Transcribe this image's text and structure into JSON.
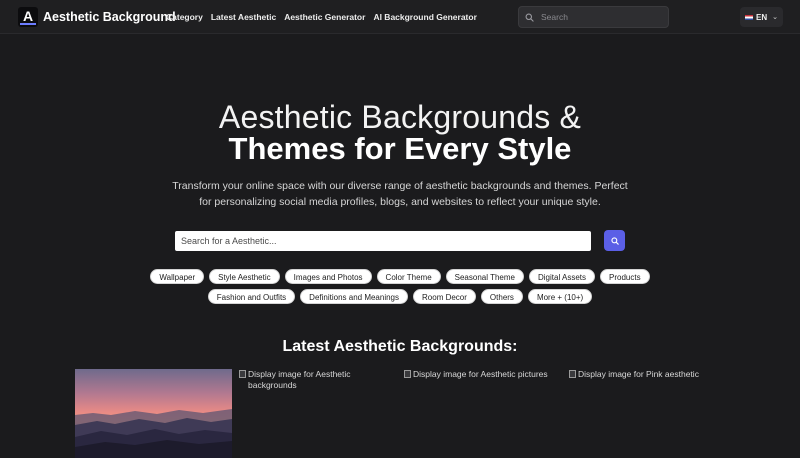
{
  "header": {
    "logo_letter": "A",
    "brand": "Aesthetic Background",
    "nav": [
      "Category",
      "Latest Aesthetic",
      "Aesthetic Generator",
      "AI Background Generator"
    ],
    "search_placeholder": "Search",
    "lang": "EN",
    "icons": [
      "search-icon",
      "flag-icon",
      "chevron-down-icon"
    ]
  },
  "hero": {
    "line1": "Aesthetic Backgrounds &",
    "line2": "Themes for Every Style",
    "subtitle": "Transform your online space with our diverse range of aesthetic backgrounds and themes. Perfect for personalizing social media profiles, blogs, and websites to reflect your unique style.",
    "search_placeholder": "Search for a Aesthetic...",
    "search_button_icon": "search-icon"
  },
  "categories": [
    "Wallpaper",
    "Style Aesthetic",
    "Images and Photos",
    "Color Theme",
    "Seasonal Theme",
    "Digital Assets",
    "Products",
    "Fashion and Outfits",
    "Definitions and Meanings",
    "Room Decor",
    "Others",
    "More + (10+)"
  ],
  "latest": {
    "title": "Latest Aesthetic Backgrounds:",
    "images": [
      {
        "alt": ""
      },
      {
        "alt": "Display image for Aesthetic backgrounds"
      },
      {
        "alt": "Display image for Aesthetic pictures"
      },
      {
        "alt": "Display image for Pink aesthetic"
      }
    ]
  },
  "colors": {
    "background": "#1b1b1d",
    "accent": "#5b5fe6",
    "chip_bg": "#ffffff"
  }
}
